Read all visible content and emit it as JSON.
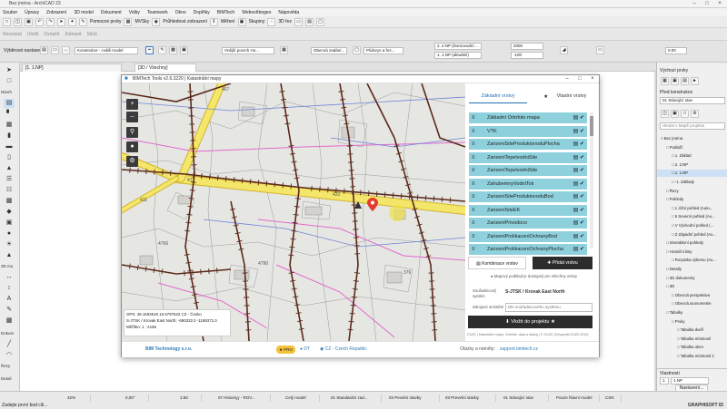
{
  "app": {
    "title": "Bez jména - ArchiCAD 23"
  },
  "menu": [
    "Soubor",
    "Úpravy",
    "Zobrazení",
    "3D model",
    "Dokument",
    "Volby",
    "Teamwork",
    "Okno",
    "Doplňky",
    "BIMTech",
    "Webověbogeo",
    "Nápověda"
  ],
  "toolbar1": {
    "labels": [
      "Pomocné prvky",
      "MVSky",
      "Průhledové zobrazení",
      "Měření",
      "Skupiny",
      "3D řez"
    ]
  },
  "toolbar2": {
    "labels": [
      "Nesvázat",
      "Uložit",
      "Označit",
      "Zobrazit",
      "Skrýt"
    ]
  },
  "infobox": {
    "left_label": "Výběrové nastavení",
    "construction": "Konstrukce - cválě model",
    "outer_line": "Vnější povrch Ho...",
    "category": "Obecná zadání...",
    "floor_plan": "Půdorys a řez...",
    "floor_top": "2. 2.NP (Domovodní ...",
    "floor_bottom": "1. 1.NP (aktuální)",
    "height_top": "2000",
    "height_bottom": "-100",
    "right_value": "0.00"
  },
  "view_tabs": [
    "[1. 1.NP]",
    "[3D / Všechny]"
  ],
  "toolbox": {
    "headers": [
      "Návrh",
      "3D mo",
      "Dokum",
      "Řezy",
      "Detail"
    ]
  },
  "dialog": {
    "title": "BIMTech Tools v2.6.3220 | Katastrální mapy",
    "tab_basic": "Základní vrstvy",
    "tab_own": "Vlastní vrstvy",
    "layers": [
      "Základní Ortofoto mapa",
      "VTK",
      "ZarizeniSiteProduktovoduPlocha",
      "ZarizeniTepelvodniSite",
      "ZarizeniTepelvodniSite",
      "ZahubemnyVodniTok",
      "ZarizeniSiteProduktovoduBod",
      "ZarizeniSiteEK",
      "ZarizeniPrivodoco",
      "ZarizeniProlikaceniOchranyBod",
      "ZarizeniProlikaceniOchranyPlocha"
    ],
    "combine_button": "Kombinace vrstev",
    "add_layer_button": "Přidat vrstvu",
    "map_status": "Mapový podklad je dostupný pro všechny vrstvy",
    "coord_system_label": "Souřadnicový systém",
    "coord_system_value": "S-JTSK / Krovak East North",
    "origin_label": "Zdrojové umístění",
    "origin_value": "Dle souřadnicového systému",
    "insert_button": "Vložit do projektu",
    "attribution": "ČÚZK | Katastrální mapa, Ortofoto, data a stavby | © ČÚZK (Geoportál ČÚZK 2019)",
    "coords": {
      "gps": "GPS: 49.1593618 16.5797522 CZ - Česko",
      "sjtsk": "S-JTSK / Krovak East North: -690322.0 -1169371.0",
      "scale": "Měřítko: 1 : 2166"
    },
    "footer_company": "BIM Technology s.r.o.",
    "footer_pro": "PRO",
    "footer_user": "DT",
    "footer_country": "CZ - Czech Republic",
    "footer_support_label": "Otázky a náměty:",
    "footer_support_link": "support.bimtech.cz",
    "map_labels": [
      "471",
      "420",
      "4766",
      "4790",
      "467",
      "376",
      "411"
    ],
    "colors": {
      "layer_bg": "#8ed1dd",
      "active_layer": "#3f5a6a",
      "insert_button": "#2c2c2c",
      "road": "#f3e66b",
      "road_outline": "#d2b52b",
      "cable": "#5a2a1a",
      "pink_line": "#e26acd",
      "blue_line": "#6f85d8",
      "marker": "#e53b2e",
      "highlight": "#f2e23c"
    }
  },
  "navigator": {
    "title": "Výchozí prvky",
    "section": "Před konstrukce",
    "dropdown": "01 Stávající stav",
    "search_placeholder": "Hledat v Mapě projektu",
    "tree": [
      "Bez jména",
      "Podlaží",
      "1. Základ",
      "2. 2.NP",
      "1. 1.NP",
      "-1. Základy",
      "Řezy",
      "Pohledy",
      "1 Jižní pohled (Auto...",
      "5 Severní pohled (Au...",
      "V Východní pohled (...",
      "Z Západní pohled (Au...",
      "Interaktivní pohledy",
      "Hraniční listy",
      "Rozpiska výkresu (Au...",
      "Detaily",
      "3D dokumenty",
      "3D",
      "Obecná perspektiva",
      "Obecná axonometrie",
      "Tabulky",
      "Prvky",
      "Tabulka dveří",
      "Tabulka místností",
      "Tabulka oken",
      "Tabulka místností 2"
    ],
    "props_title": "Vlastnosti",
    "props_floor_num": "1.",
    "props_floor_name": "1.NP",
    "settings_button": "Nastavení..."
  },
  "statusbar": {
    "zoom": "32%",
    "angle": "0,00°",
    "scale": "1:50",
    "layers": "07 Historiçy - ROV...",
    "model": "Celý model",
    "pen": "01 Standardní zad...",
    "model_view": "03 Pevelní stavby",
    "renovation": "03 Prevelní stavby",
    "reno_filter": "01 Stávající stav",
    "surface": "Pouze hlavní model",
    "unit": "CSN",
    "bottom_text": "Zadejte první bod cili...",
    "brand": "GRAPHISOFT ID"
  }
}
